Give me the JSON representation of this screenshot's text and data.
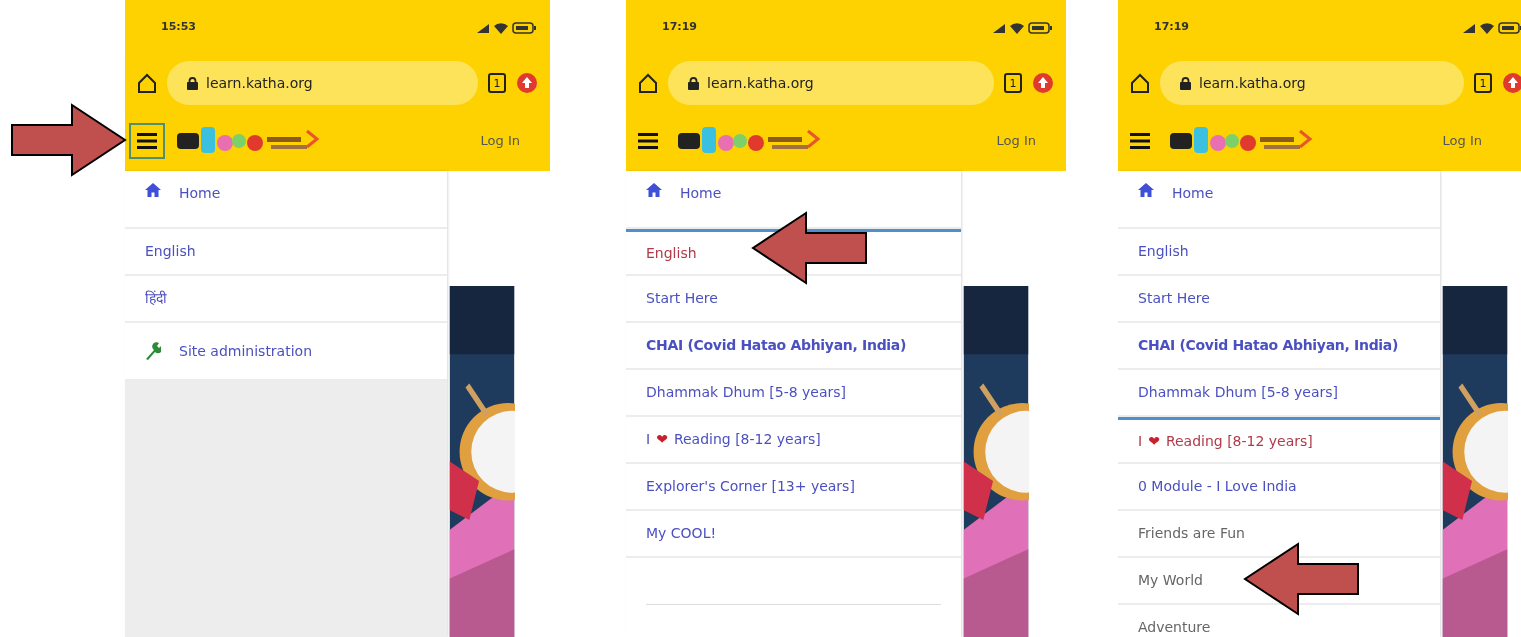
{
  "panels": [
    {
      "status_bar": {
        "time": "15:53"
      },
      "address_bar": {
        "url": "learn.katha.org",
        "tab_count": "1"
      },
      "header": {
        "menu_highlighted": true,
        "menu_pointed": true,
        "login": "Log In"
      },
      "menu": {
        "items": [
          {
            "kind": "home",
            "label": "Home",
            "selected": false,
            "muted": false,
            "bold": false,
            "pointed": false
          },
          {
            "kind": "link",
            "label": "English",
            "selected": false,
            "muted": false,
            "bold": false,
            "pointed": false
          },
          {
            "kind": "link",
            "label": "हिंदी",
            "selected": false,
            "muted": false,
            "bold": false,
            "pointed": false
          },
          {
            "kind": "admin",
            "label": "Site administration",
            "selected": false,
            "muted": false,
            "bold": false,
            "pointed": false
          }
        ]
      }
    },
    {
      "status_bar": {
        "time": "17:19"
      },
      "address_bar": {
        "url": "learn.katha.org",
        "tab_count": "1"
      },
      "header": {
        "menu_highlighted": false,
        "login": "Log In"
      },
      "menu": {
        "items": [
          {
            "kind": "home",
            "label": "Home",
            "selected": false,
            "muted": false,
            "bold": false,
            "pointed": false
          },
          {
            "kind": "link",
            "label": "English",
            "selected": true,
            "muted": false,
            "bold": false,
            "pointed": true
          },
          {
            "kind": "link",
            "label": "Start Here",
            "selected": false,
            "muted": false,
            "bold": false,
            "pointed": false
          },
          {
            "kind": "link",
            "label": "CHAI (Covid Hatao Abhiyan, India)",
            "selected": false,
            "muted": false,
            "bold": true,
            "pointed": false
          },
          {
            "kind": "link",
            "label": "Dhammak Dhum [5-8 years]",
            "selected": false,
            "muted": false,
            "bold": false,
            "pointed": false
          },
          {
            "kind": "heart",
            "prefix": "I",
            "symbol": "❤",
            "label": "Reading [8-12 years]",
            "selected": false,
            "muted": false,
            "bold": false,
            "pointed": false
          },
          {
            "kind": "link",
            "label": "Explorer's Corner [13+ years]",
            "selected": false,
            "muted": false,
            "bold": false,
            "pointed": false
          },
          {
            "kind": "link",
            "label": "My COOL!",
            "selected": false,
            "muted": false,
            "bold": false,
            "pointed": false
          },
          {
            "kind": "blank",
            "selected": false
          }
        ]
      }
    },
    {
      "status_bar": {
        "time": "17:19"
      },
      "address_bar": {
        "url": "learn.katha.org",
        "tab_count": "1"
      },
      "header": {
        "menu_highlighted": false,
        "login": "Log In"
      },
      "menu": {
        "items": [
          {
            "kind": "home",
            "label": "Home",
            "selected": false,
            "muted": false,
            "bold": false,
            "pointed": false
          },
          {
            "kind": "link",
            "label": "English",
            "selected": false,
            "muted": false,
            "bold": false,
            "pointed": false
          },
          {
            "kind": "link",
            "label": "Start Here",
            "selected": false,
            "muted": false,
            "bold": false,
            "pointed": false
          },
          {
            "kind": "link",
            "label": "CHAI (Covid Hatao Abhiyan, India)",
            "selected": false,
            "muted": false,
            "bold": true,
            "pointed": false
          },
          {
            "kind": "link",
            "label": "Dhammak Dhum [5-8 years]",
            "selected": false,
            "muted": false,
            "bold": false,
            "pointed": false
          },
          {
            "kind": "heart",
            "prefix": "I",
            "symbol": "❤",
            "label": "Reading [8-12 years]",
            "selected": true,
            "muted": false,
            "bold": false,
            "pointed": false
          },
          {
            "kind": "link",
            "label": "0 Module - I Love India",
            "selected": false,
            "muted": false,
            "bold": false,
            "pointed": false
          },
          {
            "kind": "link",
            "label": "Friends are Fun",
            "selected": false,
            "muted": true,
            "bold": false,
            "pointed": false
          },
          {
            "kind": "link",
            "label": "My World",
            "selected": false,
            "muted": true,
            "bold": false,
            "pointed": true
          },
          {
            "kind": "link",
            "label": "Adventure",
            "selected": false,
            "muted": true,
            "bold": false,
            "pointed": false
          }
        ]
      }
    }
  ]
}
